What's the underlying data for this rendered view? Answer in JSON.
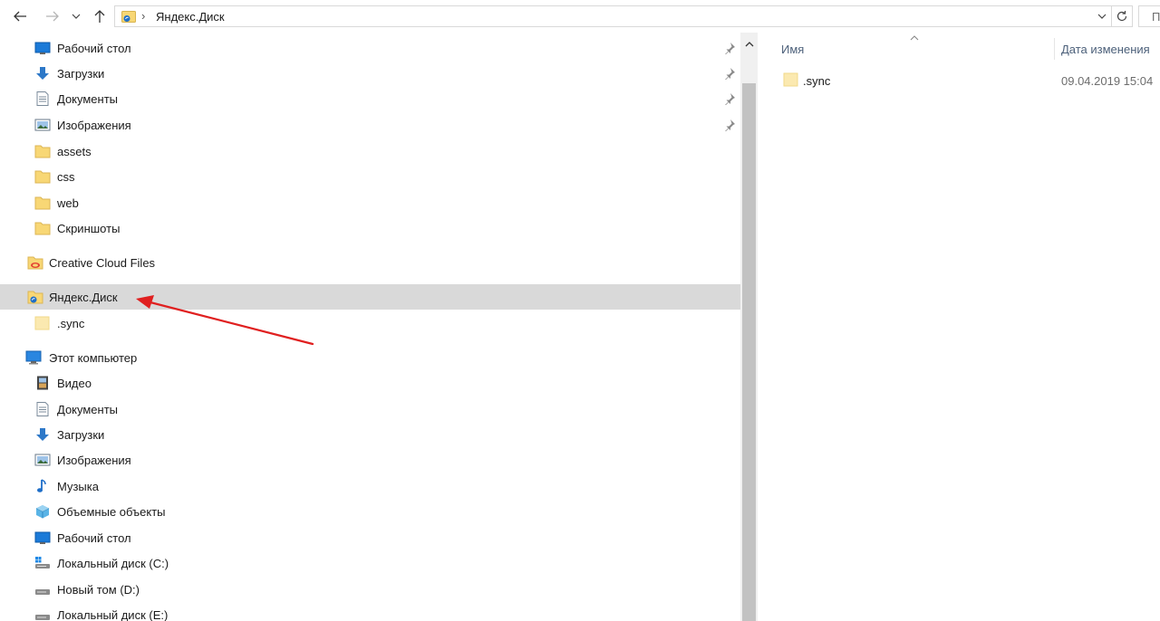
{
  "address_bar": {
    "path_separator": "›",
    "location": "Яндекс.Диск",
    "search_placeholder": "П"
  },
  "navigation": {
    "quick_access": [
      {
        "label": "Рабочий стол",
        "icon": "desktop-icon",
        "pinned": true
      },
      {
        "label": "Загрузки",
        "icon": "downloads-icon",
        "pinned": true
      },
      {
        "label": "Документы",
        "icon": "documents-icon",
        "pinned": true
      },
      {
        "label": "Изображения",
        "icon": "pictures-icon",
        "pinned": true
      },
      {
        "label": "assets",
        "icon": "folder-icon",
        "pinned": false
      },
      {
        "label": "css",
        "icon": "folder-icon",
        "pinned": false
      },
      {
        "label": "web",
        "icon": "folder-icon",
        "pinned": false
      },
      {
        "label": "Скриншоты",
        "icon": "folder-icon",
        "pinned": false
      }
    ],
    "creative_cloud": {
      "label": "Creative Cloud Files",
      "icon": "creative-cloud-folder-icon"
    },
    "yandex_disk": {
      "label": "Яндекс.Диск",
      "icon": "yandex-disk-folder-icon",
      "selected": true
    },
    "yandex_children": [
      {
        "label": ".sync",
        "icon": "folder-icon"
      }
    ],
    "this_pc": {
      "label": "Этот компьютер",
      "icon": "computer-icon"
    },
    "this_pc_children": [
      {
        "label": "Видео",
        "icon": "video-icon"
      },
      {
        "label": "Документы",
        "icon": "documents-icon"
      },
      {
        "label": "Загрузки",
        "icon": "downloads-icon"
      },
      {
        "label": "Изображения",
        "icon": "pictures-icon"
      },
      {
        "label": "Музыка",
        "icon": "music-icon"
      },
      {
        "label": "Объемные объекты",
        "icon": "3d-objects-icon"
      },
      {
        "label": "Рабочий стол",
        "icon": "desktop-icon"
      },
      {
        "label": "Локальный диск (C:)",
        "icon": "system-drive-icon"
      },
      {
        "label": "Новый том (D:)",
        "icon": "drive-icon"
      },
      {
        "label": "Локальный диск (E:)",
        "icon": "drive-icon"
      }
    ]
  },
  "content": {
    "columns": {
      "name": "Имя",
      "date_modified": "Дата изменения"
    },
    "rows": [
      {
        "name": ".sync",
        "date_modified": "09.04.2019 15:04",
        "icon": "folder-icon"
      }
    ]
  },
  "colors": {
    "selected_bg": "#d9d9d9",
    "header_text": "#4c607a",
    "annotation_arrow": "#e02020",
    "folder_yellow": "#f8d775"
  }
}
